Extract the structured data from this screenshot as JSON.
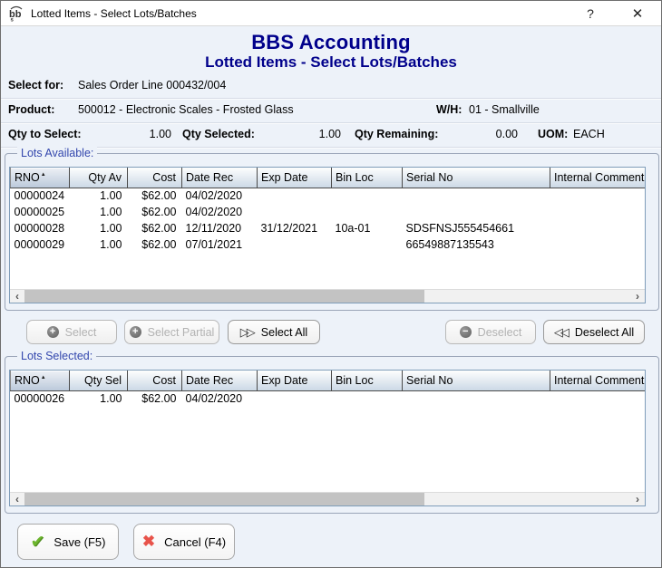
{
  "window": {
    "title": "Lotted Items - Select Lots/Batches"
  },
  "icons": {
    "help": "?",
    "close": "✕",
    "select_plus": "+",
    "deselect_minus": "−",
    "select_all_arrows": "▷▷",
    "deselect_all_arrows": "◁◁",
    "save_check": "✔",
    "cancel_cross": "✖",
    "scroll_left": "‹",
    "scroll_right": "›",
    "sort_ascending": "▲"
  },
  "header": {
    "title": "BBS Accounting",
    "subtitle": "Lotted Items - Select Lots/Batches"
  },
  "info": {
    "select_for_label": "Select for:",
    "select_for_value": "Sales Order Line 000432/004",
    "product_label": "Product:",
    "product_value": "500012 - Electronic Scales - Frosted Glass",
    "wh_label": "W/H:",
    "wh_value": "01 - Smallville",
    "qty_to_select_label": "Qty to Select:",
    "qty_to_select_value": "1.00",
    "qty_selected_label": "Qty Selected:",
    "qty_selected_value": "1.00",
    "qty_remaining_label": "Qty Remaining:",
    "qty_remaining_value": "0.00",
    "uom_label": "UOM:",
    "uom_value": "EACH"
  },
  "lots_available": {
    "legend": "Lots Available:",
    "sort_column": 0,
    "columns": [
      "RNO",
      "Qty Av",
      "Cost",
      "Date Rec",
      "Exp Date",
      "Bin Loc",
      "Serial No",
      "Internal Comment"
    ],
    "rows": [
      [
        "00000024",
        "1.00",
        "$62.00",
        "04/02/2020",
        "",
        "",
        "",
        ""
      ],
      [
        "00000025",
        "1.00",
        "$62.00",
        "04/02/2020",
        "",
        "",
        "",
        ""
      ],
      [
        "00000028",
        "1.00",
        "$62.00",
        "12/11/2020",
        "31/12/2021",
        "10a-01",
        "SDSFNSJ555454661",
        ""
      ],
      [
        "00000029",
        "1.00",
        "$62.00",
        "07/01/2021",
        "",
        "",
        "66549887135543",
        ""
      ]
    ]
  },
  "lots_selected": {
    "legend": "Lots Selected:",
    "sort_column": 0,
    "columns": [
      "RNO",
      "Qty Sel",
      "Cost",
      "Date Rec",
      "Exp Date",
      "Bin Loc",
      "Serial No",
      "Internal Comment"
    ],
    "rows": [
      [
        "00000026",
        "1.00",
        "$62.00",
        "04/02/2020",
        "",
        "",
        "",
        ""
      ]
    ]
  },
  "actions": {
    "select": "Select",
    "select_partial": "Select Partial",
    "select_all": "Select All",
    "deselect": "Deselect",
    "deselect_all": "Deselect All"
  },
  "footer": {
    "save": "Save (F5)",
    "cancel": "Cancel (F4)"
  },
  "colors": {
    "header_navy": "#00008b",
    "legend_blue": "#3347ad",
    "dialog_bg": "#edf2f9",
    "grid_border": "#7f9db9",
    "save_green": "#6cb52d",
    "cancel_red": "#e8534a"
  }
}
